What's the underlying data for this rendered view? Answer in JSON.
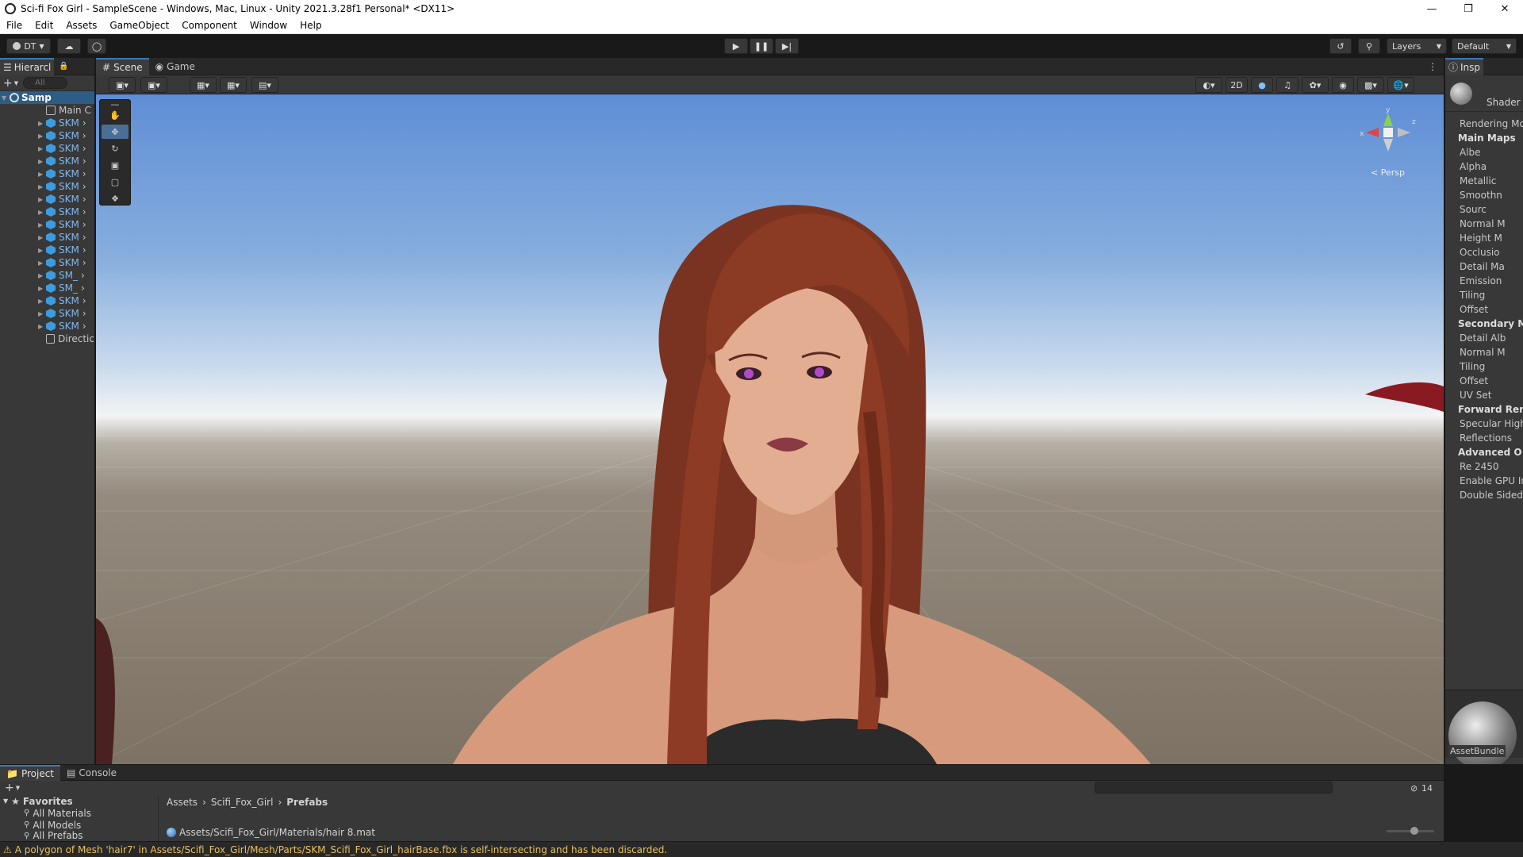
{
  "window": {
    "title": "Sci-fi Fox Girl - SampleScene - Windows, Mac, Linux - Unity 2021.3.28f1 Personal* <DX11>",
    "minimize_icon": "minimize-icon",
    "maximize_icon": "maximize-icon",
    "close_icon": "close-icon"
  },
  "menu": [
    "File",
    "Edit",
    "Assets",
    "GameObject",
    "Component",
    "Window",
    "Help"
  ],
  "toolbar": {
    "account_label": "DT",
    "layers_label": "Layers",
    "layout_label": "Default"
  },
  "hierarchy": {
    "tab_label": "Hierarcl",
    "search_placeholder": "All",
    "scene_name": "Samp",
    "items": [
      {
        "label": "Main C",
        "icon": "camera-icon",
        "prefab": false
      },
      {
        "label": "SKM",
        "icon": "prefab-icon",
        "prefab": true
      },
      {
        "label": "SKM",
        "icon": "prefab-icon",
        "prefab": true
      },
      {
        "label": "SKM",
        "icon": "prefab-icon",
        "prefab": true
      },
      {
        "label": "SKM",
        "icon": "prefab-icon",
        "prefab": true
      },
      {
        "label": "SKM",
        "icon": "prefab-icon",
        "prefab": true
      },
      {
        "label": "SKM",
        "icon": "prefab-icon",
        "prefab": true
      },
      {
        "label": "SKM",
        "icon": "prefab-icon",
        "prefab": true
      },
      {
        "label": "SKM",
        "icon": "prefab-icon",
        "prefab": true
      },
      {
        "label": "SKM",
        "icon": "prefab-icon",
        "prefab": true
      },
      {
        "label": "SKM",
        "icon": "prefab-icon",
        "prefab": true
      },
      {
        "label": "SKM",
        "icon": "prefab-icon",
        "prefab": true
      },
      {
        "label": "SKM",
        "icon": "prefab-icon",
        "prefab": true
      },
      {
        "label": "SM_",
        "icon": "prefab-icon",
        "prefab": true
      },
      {
        "label": "SM_",
        "icon": "prefab-icon",
        "prefab": true
      },
      {
        "label": "SKM",
        "icon": "prefab-icon",
        "prefab": true
      },
      {
        "label": "SKM",
        "icon": "prefab-icon",
        "prefab": true
      },
      {
        "label": "SKM",
        "icon": "prefab-icon",
        "prefab": true
      },
      {
        "label": "Directic",
        "icon": "light-icon",
        "prefab": false
      }
    ]
  },
  "scene": {
    "tabs": [
      "Scene",
      "Game"
    ],
    "mode_2d": "2D",
    "persp_label": "< Persp",
    "gizmo_axes": {
      "y": "y",
      "x": "x",
      "z": "z"
    }
  },
  "inspector": {
    "tab_label": "Insp",
    "shader_label": "Shader",
    "rows": [
      {
        "label": "Rendering Mo",
        "bold": false
      },
      {
        "label": "Main Maps",
        "bold": true
      },
      {
        "label": "Albe",
        "bold": false
      },
      {
        "label": "Alpha",
        "bold": false
      },
      {
        "label": "Metallic",
        "bold": false
      },
      {
        "label": "Smoothn",
        "bold": false
      },
      {
        "label": "Sourc",
        "bold": false
      },
      {
        "label": "Normal M",
        "bold": false
      },
      {
        "label": "Height M",
        "bold": false
      },
      {
        "label": "Occlusio",
        "bold": false
      },
      {
        "label": "Detail Ma",
        "bold": false
      },
      {
        "label": "Emission",
        "bold": false
      },
      {
        "label": "Tiling",
        "bold": false
      },
      {
        "label": "Offset",
        "bold": false
      },
      {
        "label": "Secondary M",
        "bold": true
      },
      {
        "label": "Detail Alb",
        "bold": false
      },
      {
        "label": "Normal M",
        "bold": false
      },
      {
        "label": "Tiling",
        "bold": false
      },
      {
        "label": "Offset",
        "bold": false
      },
      {
        "label": "UV Set",
        "bold": false
      },
      {
        "label": "Forward Ren",
        "bold": true
      },
      {
        "label": "Specular High",
        "bold": false
      },
      {
        "label": "Reflections",
        "bold": false
      },
      {
        "label": "Advanced O",
        "bold": true
      },
      {
        "label": "Re 2450",
        "bold": false
      },
      {
        "label": "Enable GPU In",
        "bold": false
      },
      {
        "label": "Double Sided",
        "bold": false
      }
    ],
    "asset_bundle_label": "AssetBundle"
  },
  "project": {
    "tabs": [
      "Project",
      "Console"
    ],
    "favorites_label": "Favorites",
    "favorites": [
      "All Materials",
      "All Models",
      "All Prefabs"
    ],
    "breadcrumb": [
      "Assets",
      "Scifi_Fox_Girl",
      "Prefabs"
    ],
    "selected_path": "Assets/Scifi_Fox_Girl/Materials/hair 8.mat",
    "hidden_count": "14"
  },
  "status": {
    "message": "A polygon of Mesh 'hair7' in Assets/Scifi_Fox_Girl/Mesh/Parts/SKM_Scifi_Fox_Girl_hairBase.fbx is self-intersecting and has been discarded."
  },
  "colors": {
    "accent_blue": "#3a79bb",
    "prefab_blue": "#3d9be0",
    "warning_yellow": "#e9c15a"
  }
}
